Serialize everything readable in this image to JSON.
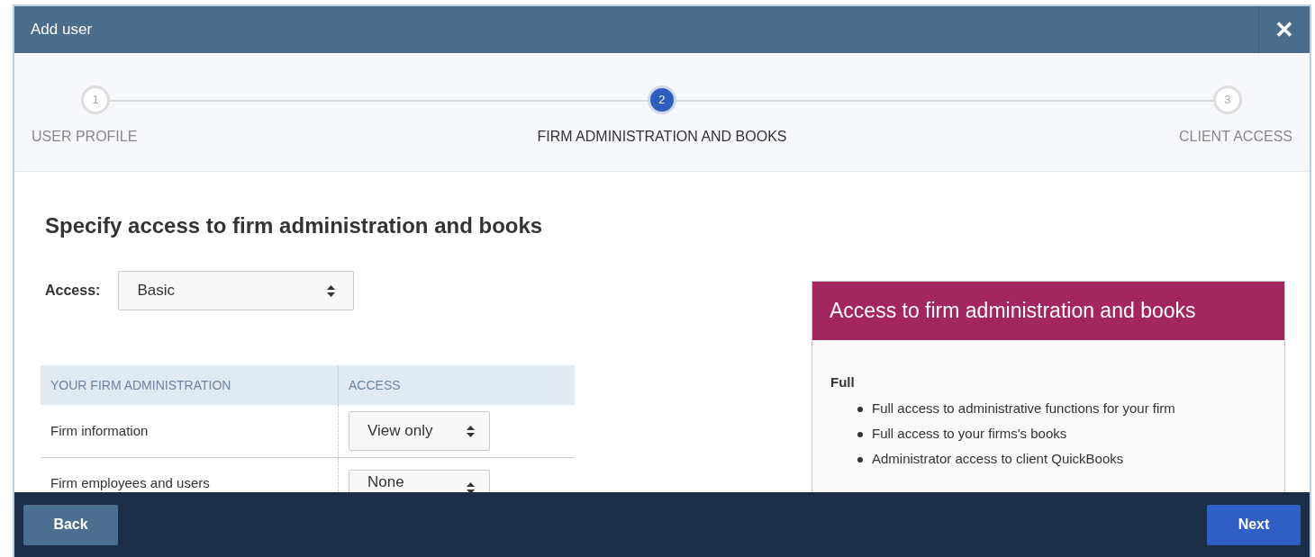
{
  "window": {
    "title": "Add user",
    "close": "✕"
  },
  "steps": [
    {
      "number": "1",
      "label": "USER PROFILE",
      "selected": false
    },
    {
      "number": "2",
      "label": "FIRM ADMINISTRATION AND BOOKS",
      "selected": true
    },
    {
      "number": "3",
      "label": "CLIENT ACCESS",
      "selected": false
    }
  ],
  "heading": "Specify access to firm administration and books",
  "access": {
    "label": "Access:",
    "value": "Basic"
  },
  "table": {
    "columns": [
      "YOUR FIRM ADMINISTRATION",
      "ACCESS"
    ],
    "rows": [
      {
        "name": "Firm information",
        "access": "View only"
      },
      {
        "name": "Firm employees and users",
        "access": "None"
      }
    ]
  },
  "info_panel": {
    "title": "Access to firm administration and books",
    "level_name": "Full",
    "bullets": [
      "Full access to administrative functions for your firm",
      "Full access to your firms's books",
      "Administrator access to client QuickBooks"
    ]
  },
  "footer": {
    "back": "Back",
    "next": "Next"
  }
}
